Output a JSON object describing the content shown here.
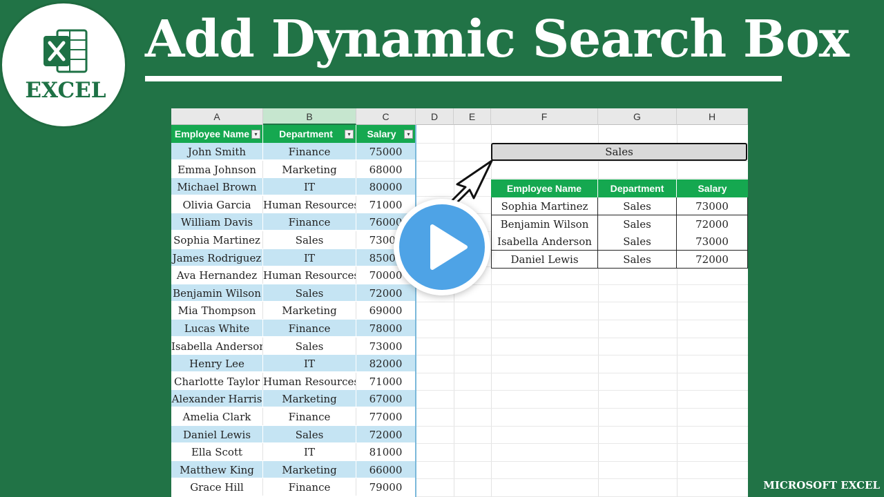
{
  "header": {
    "title": "Add Dynamic Search Box",
    "logo_text": "EXCEL",
    "footer_label": "MICROSOFT EXCEL"
  },
  "sheet": {
    "columns": [
      "A",
      "B",
      "C",
      "D",
      "E",
      "F",
      "G",
      "H"
    ],
    "search_value": "Sales",
    "left_table": {
      "headers": [
        "Employee Name",
        "Department",
        "Salary"
      ],
      "rows": [
        [
          "John Smith",
          "Finance",
          "75000"
        ],
        [
          "Emma Johnson",
          "Marketing",
          "68000"
        ],
        [
          "Michael Brown",
          "IT",
          "80000"
        ],
        [
          "Olivia Garcia",
          "Human Resources",
          "71000"
        ],
        [
          "William Davis",
          "Finance",
          "76000"
        ],
        [
          "Sophia Martinez",
          "Sales",
          "73000"
        ],
        [
          "James Rodriguez",
          "IT",
          "85000"
        ],
        [
          "Ava Hernandez",
          "Human Resources",
          "70000"
        ],
        [
          "Benjamin Wilson",
          "Sales",
          "72000"
        ],
        [
          "Mia Thompson",
          "Marketing",
          "69000"
        ],
        [
          "Lucas White",
          "Finance",
          "78000"
        ],
        [
          "Isabella Anderson",
          "Sales",
          "73000"
        ],
        [
          "Henry Lee",
          "IT",
          "82000"
        ],
        [
          "Charlotte Taylor",
          "Human Resources",
          "71000"
        ],
        [
          "Alexander Harris",
          "Marketing",
          "67000"
        ],
        [
          "Amelia Clark",
          "Finance",
          "77000"
        ],
        [
          "Daniel Lewis",
          "Sales",
          "72000"
        ],
        [
          "Ella Scott",
          "IT",
          "81000"
        ],
        [
          "Matthew King",
          "Marketing",
          "66000"
        ],
        [
          "Grace Hill",
          "Finance",
          "79000"
        ]
      ]
    },
    "result_table": {
      "headers": [
        "Employee Name",
        "Department",
        "Salary"
      ],
      "rows": [
        [
          "Sophia Martinez",
          "Sales",
          "73000"
        ],
        [
          "Benjamin Wilson",
          "Sales",
          "72000"
        ],
        [
          "Isabella Anderson",
          "Sales",
          "73000"
        ],
        [
          "Daniel Lewis",
          "Sales",
          "72000"
        ]
      ]
    }
  },
  "colors": {
    "background": "#217346",
    "table_header": "#15a850",
    "band": "#c5e4f3",
    "play_button": "#4ea3e6"
  },
  "icons": {
    "logo": "excel-logo-icon",
    "play": "play-icon",
    "arrow": "pointer-arrow-icon",
    "dropdown": "filter-dropdown-icon"
  }
}
